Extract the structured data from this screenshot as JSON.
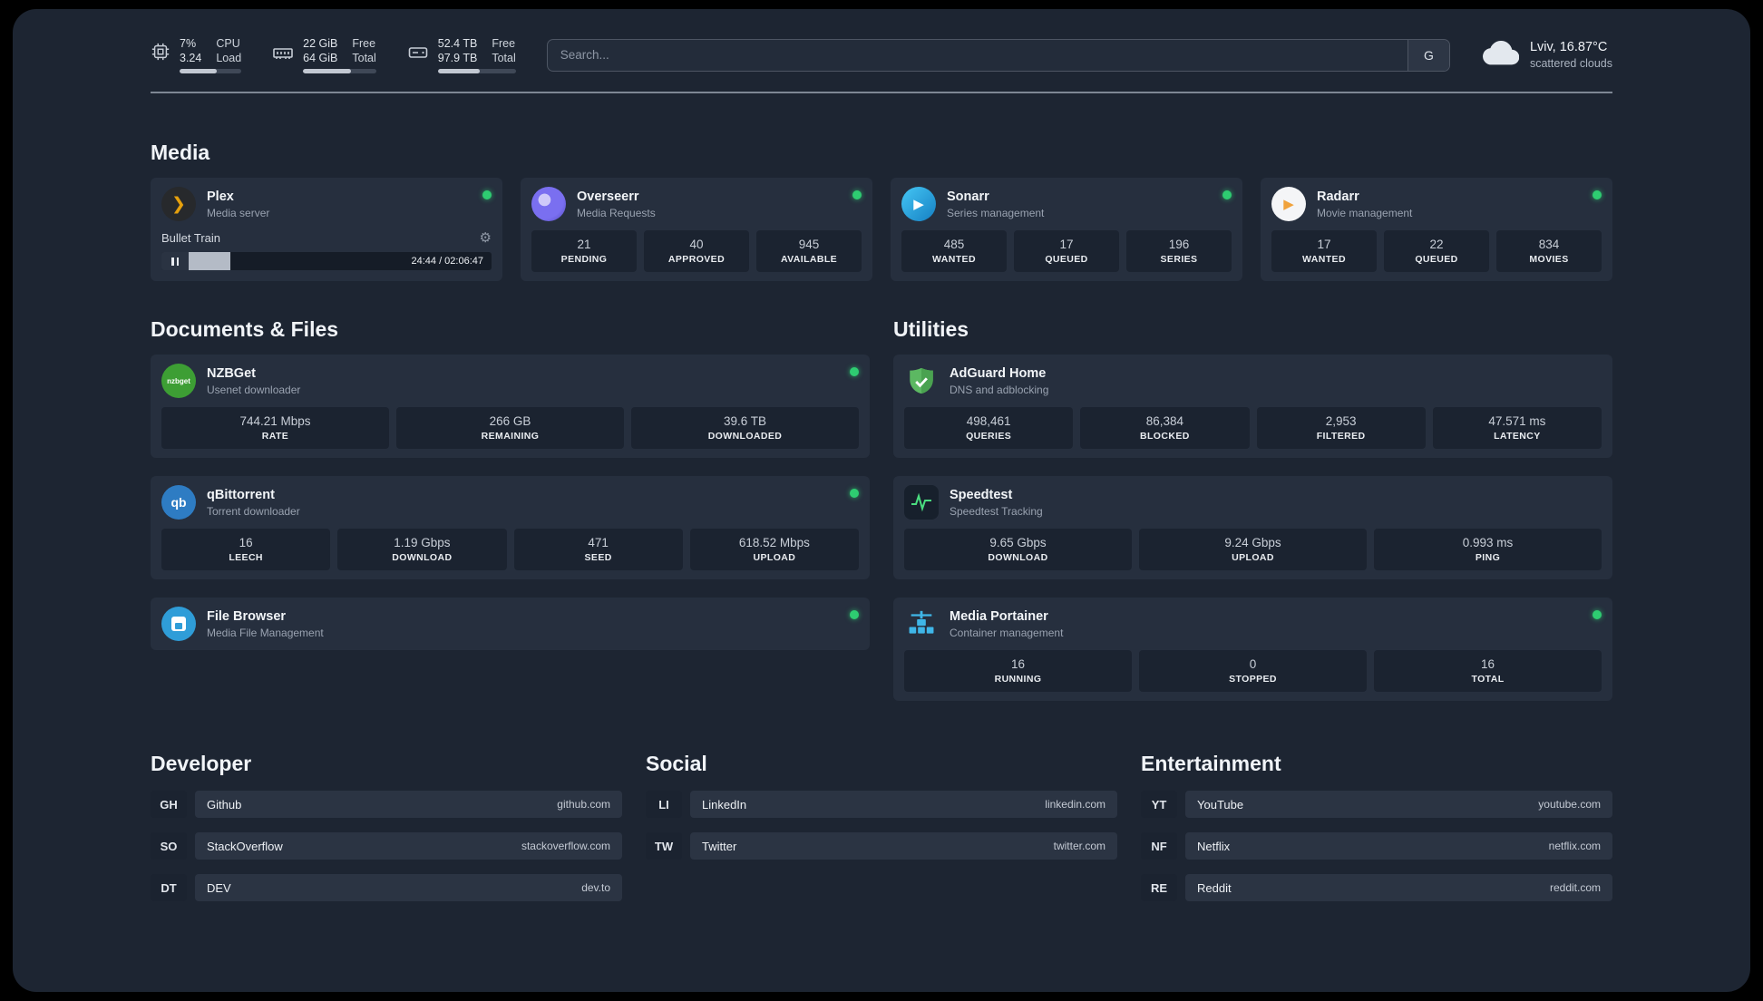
{
  "topbar": {
    "cpu": {
      "percent": "7%",
      "load": "3.24",
      "label_top": "CPU",
      "label_bottom": "Load",
      "bar": 60
    },
    "ram": {
      "free": "22 GiB",
      "total": "64 GiB",
      "label_top": "Free",
      "label_bottom": "Total",
      "bar": 66
    },
    "disk": {
      "free": "52.4 TB",
      "total": "97.9 TB",
      "label_top": "Free",
      "label_bottom": "Total",
      "bar": 54
    },
    "search": {
      "placeholder": "Search...",
      "provider": "G"
    },
    "weather": {
      "location": "Lviv, 16.87°C",
      "condition": "scattered clouds"
    }
  },
  "media": {
    "title": "Media",
    "plex": {
      "name": "Plex",
      "desc": "Media server",
      "now_playing": "Bullet Train",
      "time": "24:44 / 02:06:47",
      "progress": 19.5
    },
    "overseerr": {
      "name": "Overseerr",
      "desc": "Media Requests",
      "stats": [
        {
          "value": "21",
          "label": "PENDING"
        },
        {
          "value": "40",
          "label": "APPROVED"
        },
        {
          "value": "945",
          "label": "AVAILABLE"
        }
      ]
    },
    "sonarr": {
      "name": "Sonarr",
      "desc": "Series management",
      "stats": [
        {
          "value": "485",
          "label": "WANTED"
        },
        {
          "value": "17",
          "label": "QUEUED"
        },
        {
          "value": "196",
          "label": "SERIES"
        }
      ]
    },
    "radarr": {
      "name": "Radarr",
      "desc": "Movie management",
      "stats": [
        {
          "value": "17",
          "label": "WANTED"
        },
        {
          "value": "22",
          "label": "QUEUED"
        },
        {
          "value": "834",
          "label": "MOVIES"
        }
      ]
    }
  },
  "documents": {
    "title": "Documents & Files",
    "nzbget": {
      "name": "NZBGet",
      "desc": "Usenet downloader",
      "icon_text": "nzbget",
      "stats": [
        {
          "value": "744.21 Mbps",
          "label": "RATE"
        },
        {
          "value": "266 GB",
          "label": "REMAINING"
        },
        {
          "value": "39.6 TB",
          "label": "DOWNLOADED"
        }
      ]
    },
    "qbittorrent": {
      "name": "qBittorrent",
      "desc": "Torrent downloader",
      "icon_text": "qb",
      "stats": [
        {
          "value": "16",
          "label": "LEECH"
        },
        {
          "value": "1.19 Gbps",
          "label": "DOWNLOAD"
        },
        {
          "value": "471",
          "label": "SEED"
        },
        {
          "value": "618.52 Mbps",
          "label": "UPLOAD"
        }
      ]
    },
    "filebrowser": {
      "name": "File Browser",
      "desc": "Media File Management"
    }
  },
  "utilities": {
    "title": "Utilities",
    "adguard": {
      "name": "AdGuard Home",
      "desc": "DNS and adblocking",
      "stats": [
        {
          "value": "498,461",
          "label": "QUERIES"
        },
        {
          "value": "86,384",
          "label": "BLOCKED"
        },
        {
          "value": "2,953",
          "label": "FILTERED"
        },
        {
          "value": "47.571 ms",
          "label": "LATENCY"
        }
      ]
    },
    "speedtest": {
      "name": "Speedtest",
      "desc": "Speedtest Tracking",
      "stats": [
        {
          "value": "9.65 Gbps",
          "label": "DOWNLOAD"
        },
        {
          "value": "9.24 Gbps",
          "label": "UPLOAD"
        },
        {
          "value": "0.993 ms",
          "label": "PING"
        }
      ]
    },
    "portainer": {
      "name": "Media Portainer",
      "desc": "Container management",
      "stats": [
        {
          "value": "16",
          "label": "RUNNING"
        },
        {
          "value": "0",
          "label": "STOPPED"
        },
        {
          "value": "16",
          "label": "TOTAL"
        }
      ]
    }
  },
  "bookmarks": {
    "developer": {
      "title": "Developer",
      "items": [
        {
          "abbr": "GH",
          "name": "Github",
          "url": "github.com"
        },
        {
          "abbr": "SO",
          "name": "StackOverflow",
          "url": "stackoverflow.com"
        },
        {
          "abbr": "DT",
          "name": "DEV",
          "url": "dev.to"
        }
      ]
    },
    "social": {
      "title": "Social",
      "items": [
        {
          "abbr": "LI",
          "name": "LinkedIn",
          "url": "linkedin.com"
        },
        {
          "abbr": "TW",
          "name": "Twitter",
          "url": "twitter.com"
        }
      ]
    },
    "entertainment": {
      "title": "Entertainment",
      "items": [
        {
          "abbr": "YT",
          "name": "YouTube",
          "url": "youtube.com"
        },
        {
          "abbr": "NF",
          "name": "Netflix",
          "url": "netflix.com"
        },
        {
          "abbr": "RE",
          "name": "Reddit",
          "url": "reddit.com"
        }
      ]
    }
  }
}
